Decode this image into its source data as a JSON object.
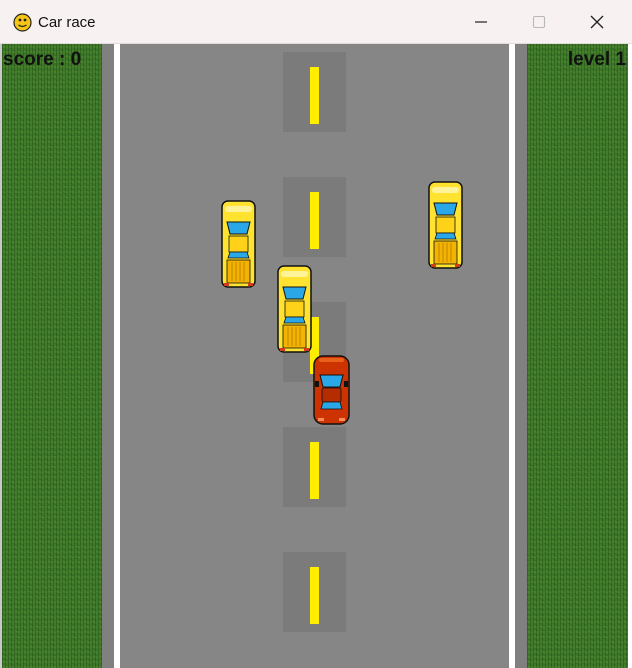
{
  "window": {
    "title": "Car race",
    "app_icon": "python-snake-icon",
    "controls": [
      "minimize-icon",
      "maximize-icon",
      "close-icon"
    ]
  },
  "hud": {
    "score_text": "score : 0",
    "level_text": "level 1"
  },
  "colors": {
    "road": "#868686",
    "lane_marker": "#ffee00",
    "grass": "#3f7a2a",
    "edge_line": "#ffffff",
    "player_car": "#cc3300",
    "enemy_car": "#ffe330"
  },
  "entities": {
    "player_car": "red-car",
    "enemy_cars": [
      "yellow-car",
      "yellow-car",
      "yellow-car"
    ],
    "lane_markers": 5
  }
}
